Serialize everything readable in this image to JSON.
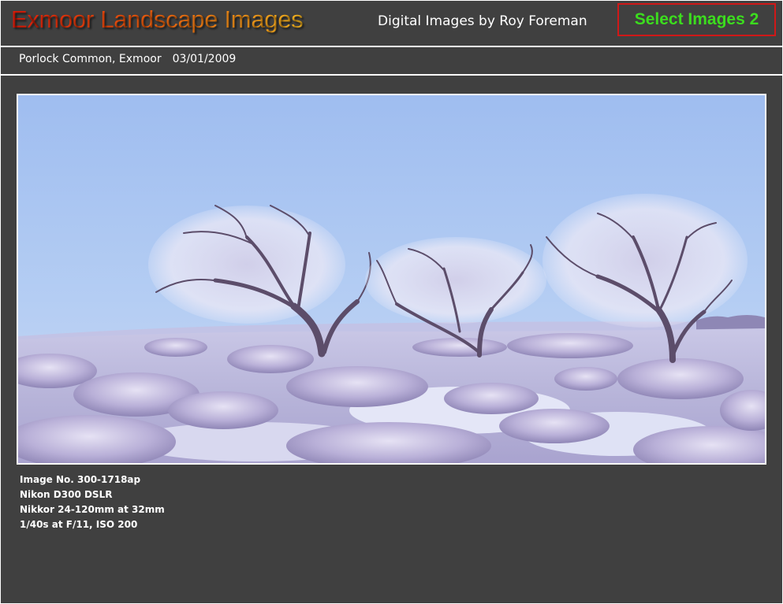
{
  "header": {
    "site_title": "Exmoor Landscape Images",
    "tagline": "Digital Images by Roy Foreman",
    "select_button": "Select Images 2"
  },
  "subheader": {
    "location": "Porlock Common, Exmoor",
    "date": "03/01/2009"
  },
  "photo": {
    "alt": "Frost-covered wind-bent trees on heathland under a pale blue sky"
  },
  "image_info": [
    "Image No. 300-1718ap",
    "Nikon D300 DSLR",
    "Nikkor 24-120mm at 32mm",
    "1/40s at F/11, ISO 200"
  ],
  "colors": {
    "background": "#404040",
    "title_gradient_start": "#e01b0a",
    "title_gradient_end": "#f5b520",
    "select_button_text": "#3cdc1e",
    "select_button_border": "#d01818"
  }
}
